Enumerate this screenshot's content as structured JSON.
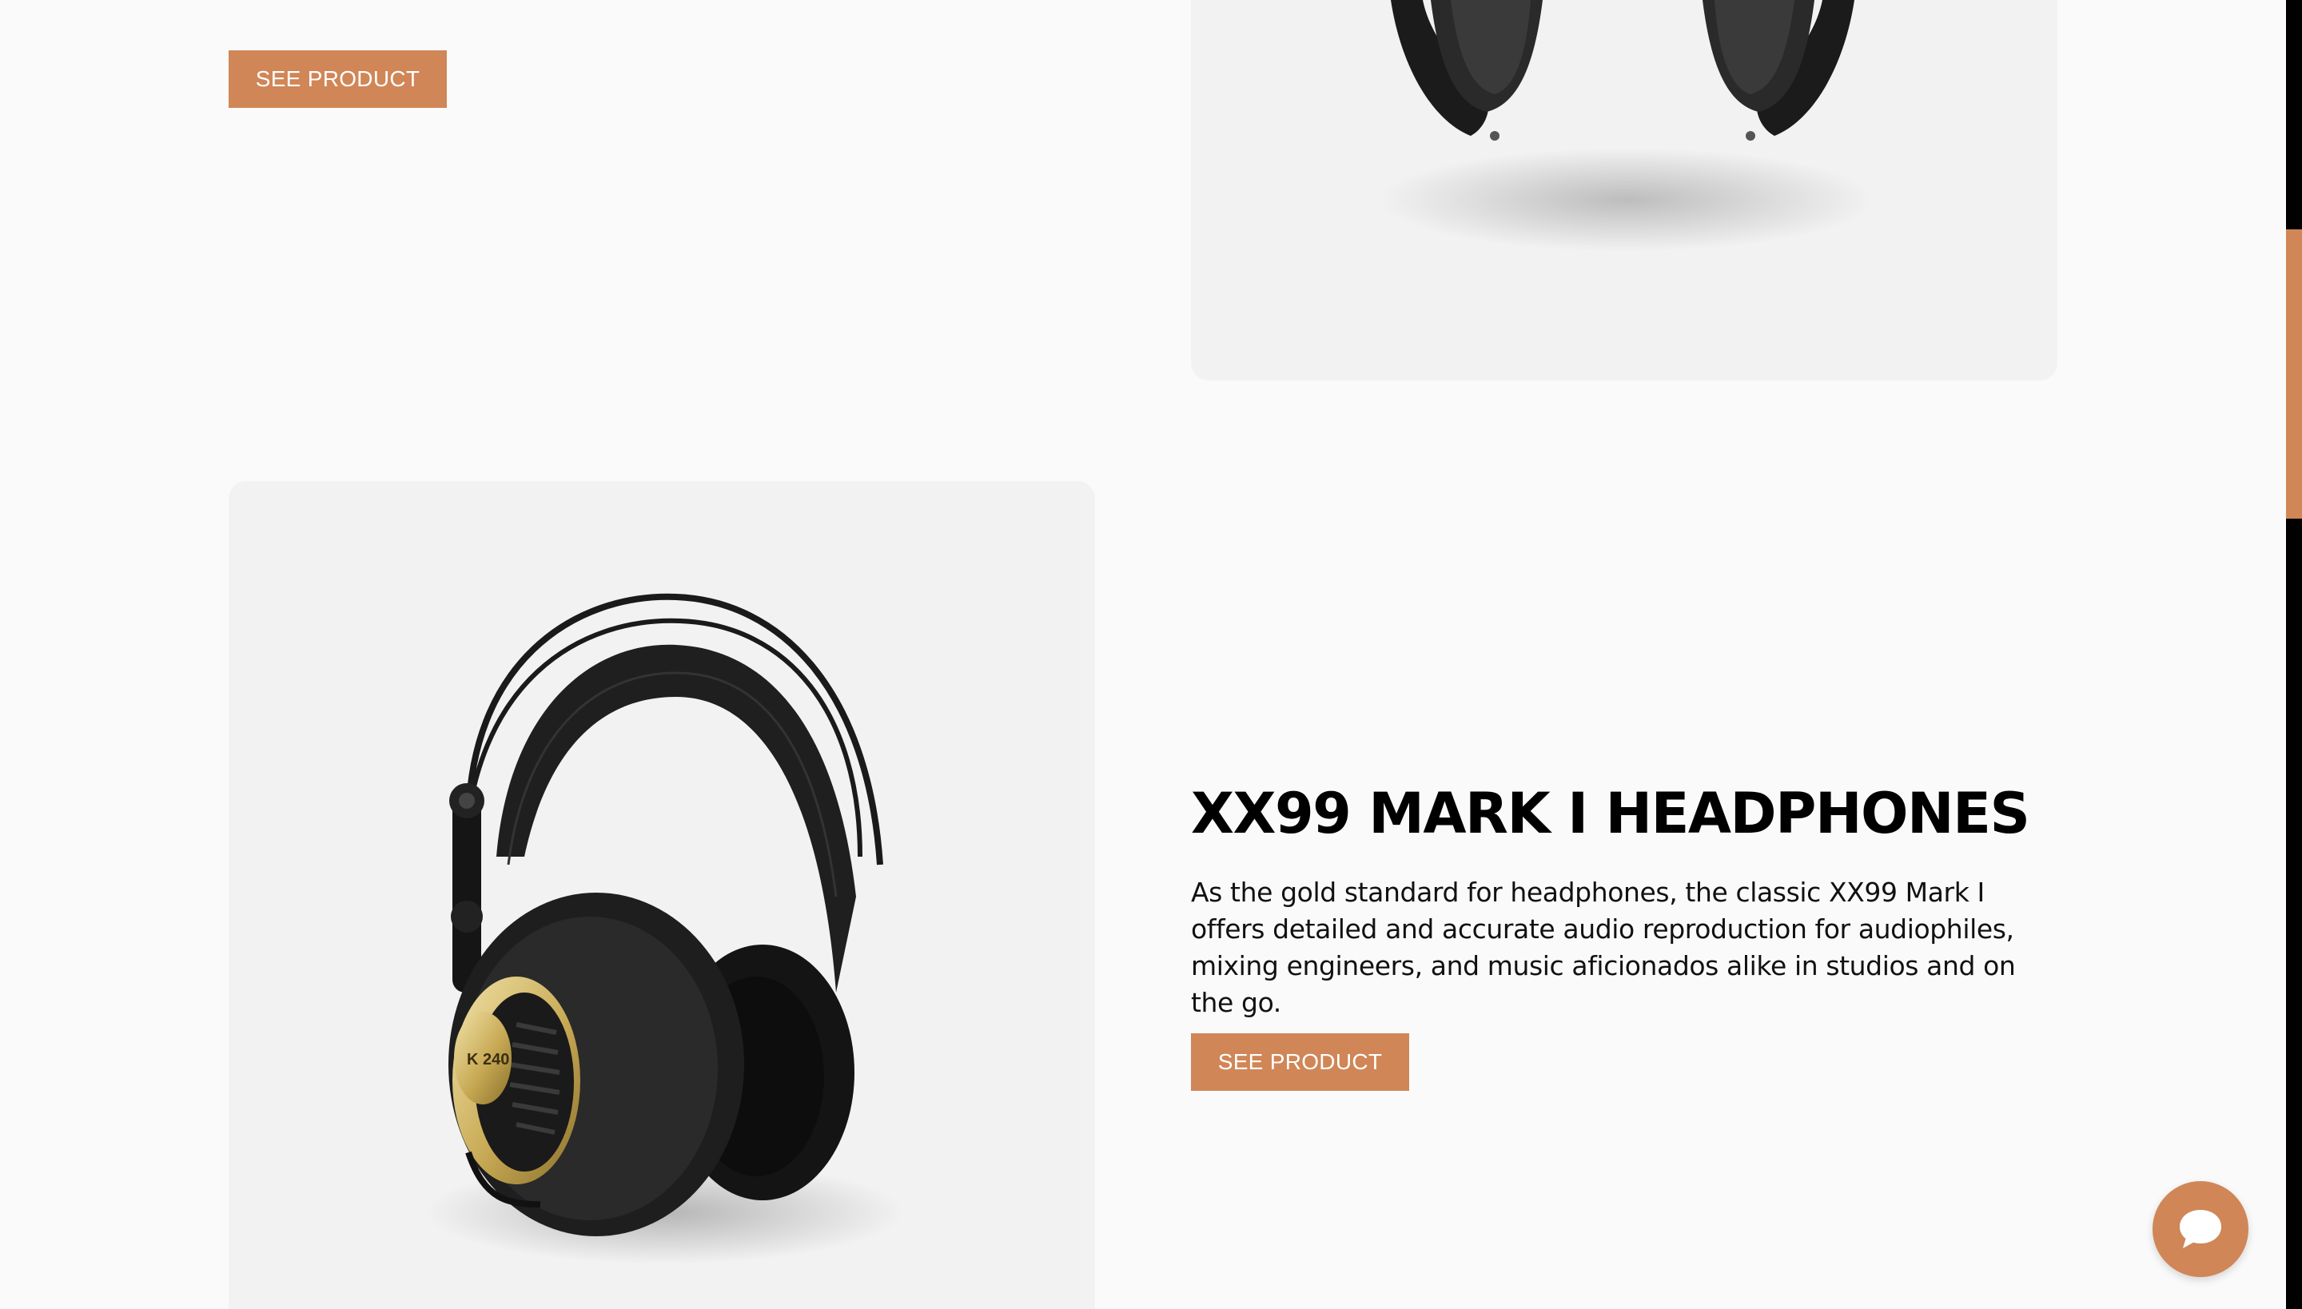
{
  "top_section": {
    "button_label": "SEE PRODUCT"
  },
  "product": {
    "title": "XX99 MARK I HEADPHONES",
    "description": "As the gold standard for headphones, the classic XX99 Mark I offers detailed and accurate audio reproduction for audiophiles, mixing engineers, and music aficionados alike in studios and on the go.",
    "button_label": "SEE PRODUCT"
  },
  "colors": {
    "accent": "#d08657",
    "page_background": "#fafafa",
    "card_background": "#f2f2f2",
    "scrollbar_track": "#000000"
  },
  "icons": {
    "chat": "chat-bubble-icon"
  }
}
